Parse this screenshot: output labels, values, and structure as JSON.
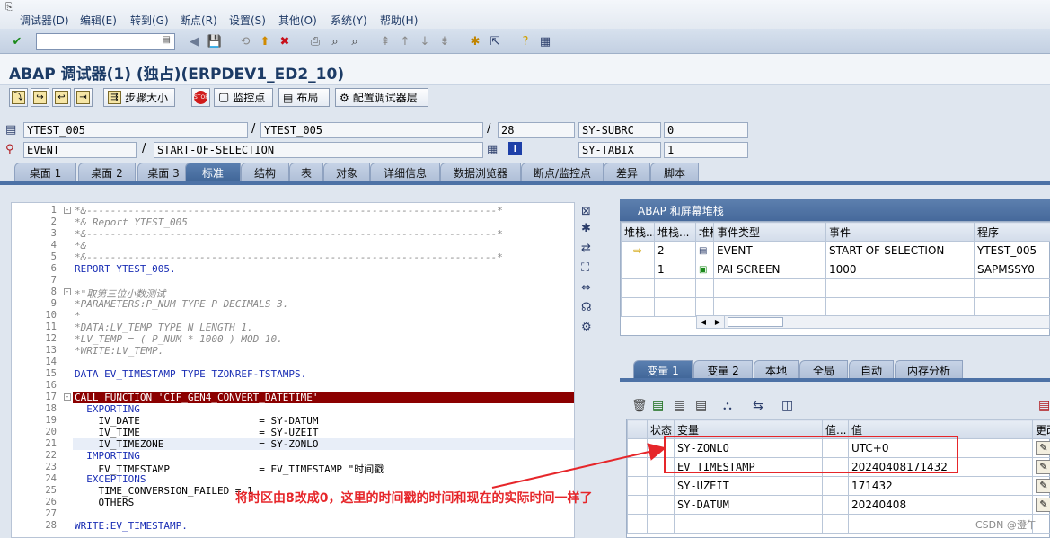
{
  "menubar": {
    "items": [
      "调试器(D)",
      "编辑(E)",
      "转到(G)",
      "断点(R)",
      "设置(S)",
      "其他(O)",
      "系统(Y)",
      "帮助(H)"
    ]
  },
  "title": "ABAP 调试器(1) (独占)(ERPDEV1_ED2_10)",
  "app_toolbar": {
    "step_size": "步骤大小",
    "watchpoint": "监控点",
    "layout": "布局",
    "config_layers": "配置调试器层"
  },
  "info": {
    "program1": "YTEST_005",
    "program2": "YTEST_005",
    "line": "28",
    "event_label": "EVENT",
    "event_value": "START-OF-SELECTION",
    "subrc_label": "SY-SUBRC",
    "subrc_value": "0",
    "tabix_label": "SY-TABIX",
    "tabix_value": "1",
    "slash": "/"
  },
  "tabs": [
    "桌面 1",
    "桌面 2",
    "桌面 3",
    "标准",
    "结构",
    "表",
    "对象",
    "详细信息",
    "数据浏览器",
    "断点/监控点",
    "差异",
    "脚本"
  ],
  "code_lines": [
    {
      "n": "1",
      "t": "*&---------------------------------------------------------------------*"
    },
    {
      "n": "2",
      "t": "*& Report YTEST_005"
    },
    {
      "n": "3",
      "t": "*&---------------------------------------------------------------------*"
    },
    {
      "n": "4",
      "t": "*&"
    },
    {
      "n": "5",
      "t": "*&---------------------------------------------------------------------*"
    },
    {
      "n": "6",
      "t": "REPORT YTEST_005."
    },
    {
      "n": "7",
      "t": ""
    },
    {
      "n": "8",
      "t": "*\"取第三位小数测试"
    },
    {
      "n": "9",
      "t": "*PARAMETERS:P_NUM TYPE P DECIMALS 3."
    },
    {
      "n": "10",
      "t": "*"
    },
    {
      "n": "11",
      "t": "*DATA:LV_TEMP TYPE N LENGTH 1."
    },
    {
      "n": "12",
      "t": "*LV_TEMP = ( P_NUM * 1000 ) MOD 10."
    },
    {
      "n": "13",
      "t": "*WRITE:LV_TEMP."
    },
    {
      "n": "14",
      "t": ""
    },
    {
      "n": "15",
      "t": "DATA EV_TIMESTAMP TYPE TZONREF-TSTAMPS."
    },
    {
      "n": "16",
      "t": ""
    },
    {
      "n": "17",
      "t": "CALL FUNCTION 'CIF_GEN4_CONVERT_DATETIME'"
    },
    {
      "n": "18",
      "t": "  EXPORTING"
    },
    {
      "n": "19",
      "t": "    IV_DATE                    = SY-DATUM"
    },
    {
      "n": "20",
      "t": "    IV_TIME                    = SY-UZEIT"
    },
    {
      "n": "21",
      "t": "    IV_TIMEZONE                = SY-ZONLO"
    },
    {
      "n": "22",
      "t": "  IMPORTING"
    },
    {
      "n": "23",
      "t": "    EV_TIMESTAMP               = EV_TIMESTAMP \"时间戳"
    },
    {
      "n": "24",
      "t": "  EXCEPTIONS"
    },
    {
      "n": "25",
      "t": "    TIME_CONVERSION_FAILED = 1"
    },
    {
      "n": "26",
      "t": "    OTHERS"
    },
    {
      "n": "27",
      "t": ""
    },
    {
      "n": "28",
      "t": "WRITE:EV_TIMESTAMP."
    }
  ],
  "stack": {
    "title": "ABAP 和屏幕堆栈",
    "headers": [
      "堆栈...",
      "堆栈...",
      "堆栈",
      "事件类型",
      "事件",
      "程序"
    ],
    "rows": [
      [
        "",
        "2",
        "",
        "EVENT",
        "START-OF-SELECTION",
        "YTEST_005"
      ],
      [
        "",
        "1",
        "",
        "PAI SCREEN",
        "1000",
        "SAPMSSY0"
      ]
    ]
  },
  "var_tabs": [
    "变量 1",
    "变量 2",
    "本地",
    "全局",
    "自动",
    "内存分析"
  ],
  "vars": {
    "headers": [
      "状态",
      "变量",
      "值...",
      "值",
      "更改"
    ],
    "rows": [
      [
        "SY-ZONLO",
        "UTC+0"
      ],
      [
        "EV_TIMESTAMP",
        "20240408171432"
      ],
      [
        "SY-UZEIT",
        "171432"
      ],
      [
        "SY-DATUM",
        "20240408"
      ]
    ]
  },
  "annotation": "将时区由8改成0，这里的时间戳的时间和现在的实际时间一样了",
  "watermark": "CSDN @澄午",
  "colors": {
    "accent": "#4d72a6",
    "highlight_line": "#8b0000",
    "annotation": "#e6262a"
  }
}
